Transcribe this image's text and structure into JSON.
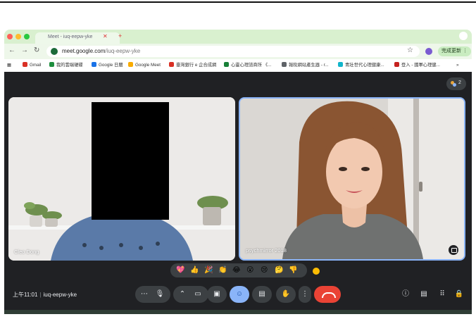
{
  "browser": {
    "tab_title": "Meet - iuq-eepw-yke",
    "url_host": "meet.google.com",
    "url_path": "/iuq-eepw-yke",
    "update_button_label": "完成更新",
    "bookmarks": [
      {
        "label": "Gmail",
        "color": "#d93025"
      },
      {
        "label": "我的雲端硬碟",
        "color": "#1e8e3e"
      },
      {
        "label": "Google 日曆",
        "color": "#1a73e8"
      },
      {
        "label": "Google Meet",
        "color": "#f9ab00"
      },
      {
        "label": "臺灣銀行 e 企合成網",
        "color": "#d93025"
      },
      {
        "label": "心靈心理諮商所 《...",
        "color": "#188038"
      },
      {
        "label": "報稅網站產生器 - r...",
        "color": "#5f6368"
      },
      {
        "label": "青壯世代心理健康...",
        "color": "#12b5cb"
      },
      {
        "label": "登入 - 國軍心理健...",
        "color": "#c5221f"
      }
    ]
  },
  "meet": {
    "participant_count": "2",
    "participants": [
      {
        "name": "Cleo Dong"
      },
      {
        "name": "psychmirror 2018"
      }
    ],
    "reactions": [
      "💖",
      "👍",
      "🎉",
      "👏",
      "😂",
      "😮",
      "😢",
      "🤔",
      "👎"
    ],
    "meeting_time": "上午11:01",
    "meeting_code": "iuq-eepw-yke",
    "colors": {
      "background": "#202124",
      "active_control": "#8ab4f8",
      "end_call": "#ea4335",
      "speaker_border": "#8ab4f8"
    }
  },
  "icons": {
    "reload": "reload-icon",
    "star": "star-icon",
    "mic": "mic-icon",
    "camera": "camera-icon",
    "present": "present-icon",
    "emoji": "emoji-icon",
    "captions": "captions-icon",
    "raise_hand": "raise-hand-icon",
    "more": "more-icon",
    "end_call": "end-call-icon",
    "info": "info-icon",
    "chat": "chat-icon",
    "activities": "activities-icon",
    "host_controls": "host-controls-icon"
  }
}
